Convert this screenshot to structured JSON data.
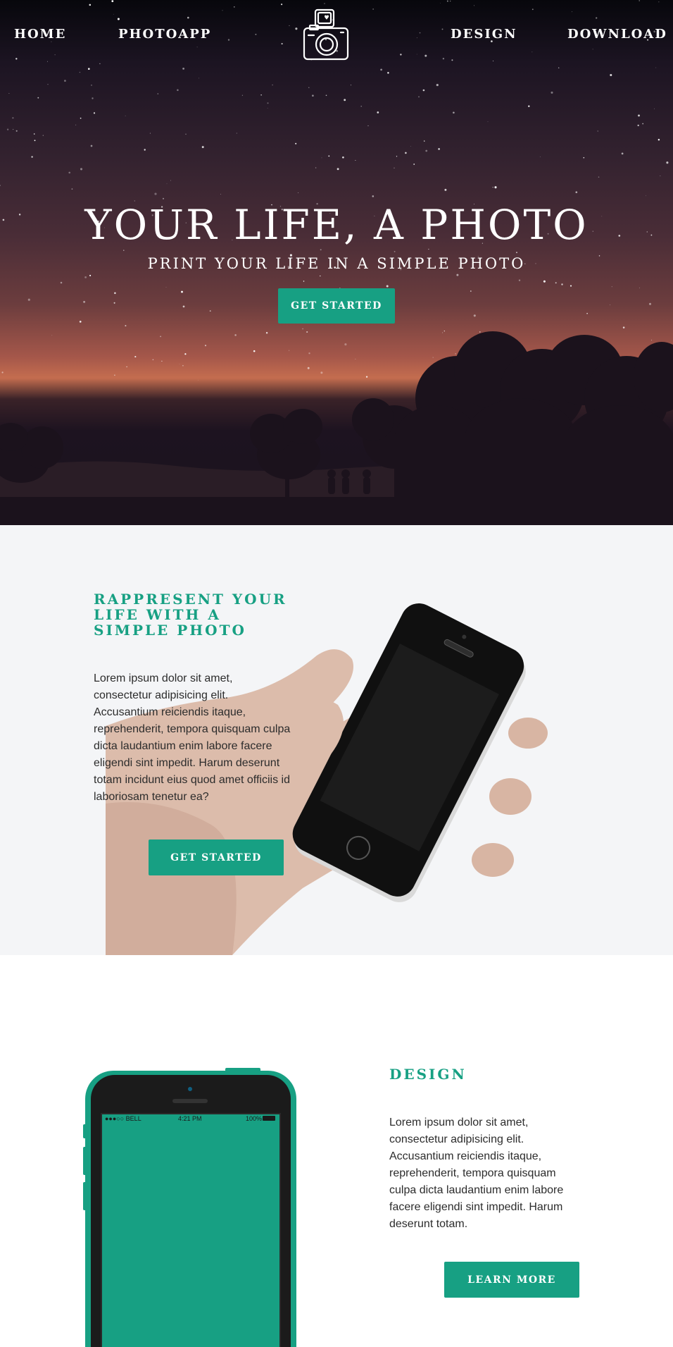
{
  "nav": {
    "home": "HOME",
    "photoapp": "PHOTOAPP",
    "design": "DESIGN",
    "download": "DOWNLOAD",
    "logo_icon": "camera-icon"
  },
  "hero": {
    "title": "YOUR LIFE, A PHOTO",
    "subtitle": "PRINT YOUR LIFE IN A SIMPLE PHOTO",
    "cta": "GET STARTED"
  },
  "represent": {
    "heading_line1": "RAPPRESENT YOUR",
    "heading_line2": "LIFE WITH A",
    "heading_line3": "SIMPLE PHOTO",
    "body": "Lorem ipsum dolor sit amet, consectetur adipisicing elit. Accusantium reiciendis itaque, reprehenderit, tempora quisquam culpa dicta laudantium enim labore facere eligendi sint impedit. Harum deserunt totam incidunt eius quod amet officiis id laboriosam tenetur ea?",
    "cta": "GET STARTED"
  },
  "design": {
    "heading": "DESIGN",
    "body": "Lorem ipsum dolor sit amet, consectetur adipisicing elit. Accusantium reiciendis itaque, reprehenderit, tempora quisquam culpa dicta laudantium enim labore facere eligendi sint impedit. Harum deserunt totam.",
    "cta": "LEARN MORE",
    "phone_status": {
      "carrier": "●●●○○ BELL",
      "time": "4:21 PM",
      "battery": "100%"
    }
  },
  "colors": {
    "accent": "#17a083",
    "section_bg": "#f4f5f7"
  }
}
